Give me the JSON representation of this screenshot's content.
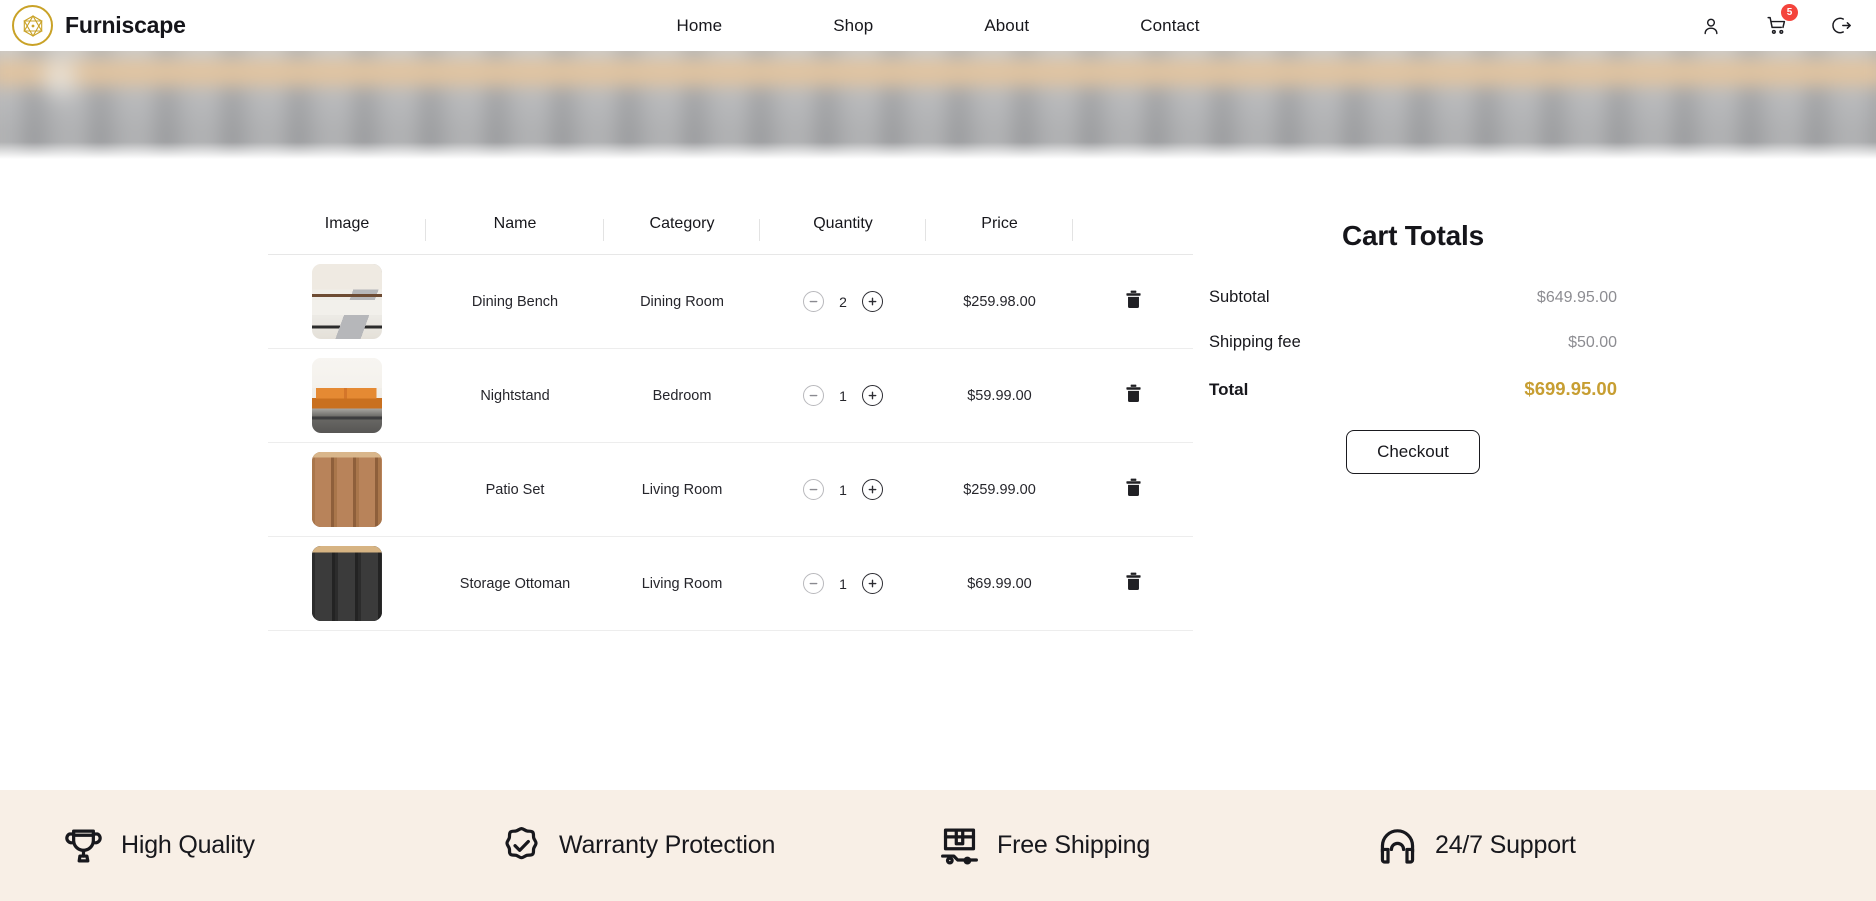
{
  "header": {
    "brand_name": "Furniscape",
    "logo_icon": "hexagon-gem-icon",
    "nav": [
      {
        "label": "Home"
      },
      {
        "label": "Shop"
      },
      {
        "label": "About"
      },
      {
        "label": "Contact"
      }
    ],
    "actions": {
      "account_icon": "user-icon",
      "cart_icon": "shopping-cart-icon",
      "cart_badge": "5",
      "logout_icon": "logout-icon"
    },
    "accent_color": "#c9a227",
    "badge_color": "#f4443c"
  },
  "hero": {
    "alt": "blurred bedroom interior banner"
  },
  "cart": {
    "columns": [
      "Image",
      "Name",
      "Category",
      "Quantity",
      "Price",
      ""
    ],
    "decrement_label": "−",
    "increment_label": "+",
    "delete_icon": "trash-icon",
    "items": [
      {
        "image": "bed-thumbnail",
        "name": "Dining Bench",
        "category": "Dining Room",
        "quantity": "2",
        "price": "$259.98.00"
      },
      {
        "image": "orange-sofa-thumbnail",
        "name": "Nightstand",
        "category": "Bedroom",
        "quantity": "1",
        "price": "$59.99.00"
      },
      {
        "image": "wood-cabinet-thumbnail",
        "name": "Patio Set",
        "category": "Living Room",
        "quantity": "1",
        "price": "$259.99.00"
      },
      {
        "image": "dark-cabinet-thumbnail",
        "name": "Storage Ottoman",
        "category": "Living Room",
        "quantity": "1",
        "price": "$69.99.00"
      }
    ]
  },
  "totals": {
    "title": "Cart Totals",
    "subtotal_label": "Subtotal",
    "subtotal_value": "$649.95.00",
    "shipping_label": "Shipping fee",
    "shipping_value": "$50.00",
    "total_label": "Total",
    "total_value": "$699.95.00",
    "total_color": "#c79e32",
    "checkout_label": "Checkout"
  },
  "features": {
    "background_color": "#f8efe6",
    "items": [
      {
        "icon": "trophy-icon",
        "label": "High Quality"
      },
      {
        "icon": "badge-check-icon",
        "label": "Warranty Protection"
      },
      {
        "icon": "package-truck-icon",
        "label": "Free Shipping"
      },
      {
        "icon": "headset-support-icon",
        "label": "24/7 Support"
      }
    ]
  }
}
